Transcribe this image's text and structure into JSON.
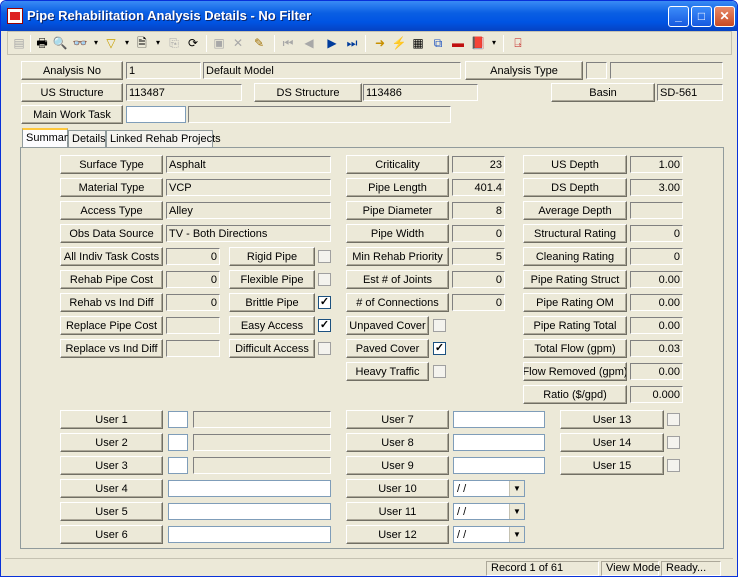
{
  "window": {
    "title": "Pipe Rehabilitation Analysis Details - No Filter"
  },
  "header": {
    "analysis_no_label": "Analysis No",
    "analysis_no": "1",
    "model": "Default Model",
    "analysis_type_label": "Analysis Type",
    "analysis_type": "",
    "analysis_type_desc": "",
    "us_structure_label": "US Structure",
    "us_structure": "113487",
    "ds_structure_label": "DS Structure",
    "ds_structure": "113486",
    "basin_label": "Basin",
    "basin": "SD-561",
    "main_work_task_label": "Main Work Task",
    "main_work_task": "",
    "main_work_task_desc": ""
  },
  "tabs": [
    {
      "label": "Summary"
    },
    {
      "label": "Details"
    },
    {
      "label": "Linked Rehab Projects"
    }
  ],
  "left_fields": [
    {
      "label": "Surface Type",
      "value": "Asphalt"
    },
    {
      "label": "Material Type",
      "value": "VCP"
    },
    {
      "label": "Access Type",
      "value": "Alley"
    },
    {
      "label": "Obs Data Source",
      "value": "TV - Both Directions"
    }
  ],
  "cost_fields": [
    {
      "label": "All Indiv Task Costs",
      "value": "0"
    },
    {
      "label": "Rehab Pipe Cost",
      "value": "0"
    },
    {
      "label": "Rehab vs Ind Diff",
      "value": "0"
    },
    {
      "label": "Replace Pipe Cost",
      "value": ""
    },
    {
      "label": "Replace vs Ind Diff",
      "value": ""
    }
  ],
  "pipe_checks": [
    {
      "label": "Rigid Pipe",
      "checked": false
    },
    {
      "label": "Flexible Pipe",
      "checked": false
    },
    {
      "label": "Brittle Pipe",
      "checked": true
    },
    {
      "label": "Easy Access",
      "checked": true
    },
    {
      "label": "Difficult Access",
      "checked": false
    }
  ],
  "mid_fields": [
    {
      "label": "Criticality",
      "value": "23"
    },
    {
      "label": "Pipe Length",
      "value": "401.4"
    },
    {
      "label": "Pipe Diameter",
      "value": "8"
    },
    {
      "label": "Pipe Width",
      "value": "0"
    },
    {
      "label": "Min Rehab Priority",
      "value": "5"
    },
    {
      "label": "Est # of Joints",
      "value": "0"
    },
    {
      "label": "# of Connections",
      "value": "0"
    }
  ],
  "cover_checks": [
    {
      "label": "Unpaved Cover",
      "checked": false
    },
    {
      "label": "Paved Cover",
      "checked": true
    },
    {
      "label": "Heavy Traffic",
      "checked": false
    }
  ],
  "right_fields": [
    {
      "label": "US Depth",
      "value": "1.00"
    },
    {
      "label": "DS Depth",
      "value": "3.00"
    },
    {
      "label": "Average Depth",
      "value": ""
    },
    {
      "label": "Structural Rating",
      "value": "0"
    },
    {
      "label": "Cleaning Rating",
      "value": "0"
    },
    {
      "label": "Pipe Rating Struct",
      "value": "0.00"
    },
    {
      "label": "Pipe Rating OM",
      "value": "0.00"
    },
    {
      "label": "Pipe Rating Total",
      "value": "0.00"
    },
    {
      "label": "Total Flow (gpm)",
      "value": "0.03"
    },
    {
      "label": "Flow Removed (gpm)",
      "value": "0.00"
    },
    {
      "label": "Ratio ($/gpd)",
      "value": "0.000"
    }
  ],
  "user_fields": [
    {
      "label": "User 1"
    },
    {
      "label": "User 2"
    },
    {
      "label": "User 3"
    },
    {
      "label": "User 4",
      "value": ""
    },
    {
      "label": "User 5",
      "value": ""
    },
    {
      "label": "User 6",
      "value": ""
    },
    {
      "label": "User 7",
      "value": ""
    },
    {
      "label": "User 8",
      "value": ""
    },
    {
      "label": "User 9",
      "value": ""
    },
    {
      "label": "User 10",
      "value": " /  /"
    },
    {
      "label": "User 11",
      "value": " /  /"
    },
    {
      "label": "User 12",
      "value": " /  /"
    },
    {
      "label": "User 13"
    },
    {
      "label": "User 14"
    },
    {
      "label": "User 15"
    }
  ],
  "status": {
    "record": "Record 1 of 61",
    "mode": "View Mode",
    "state": "Ready..."
  }
}
